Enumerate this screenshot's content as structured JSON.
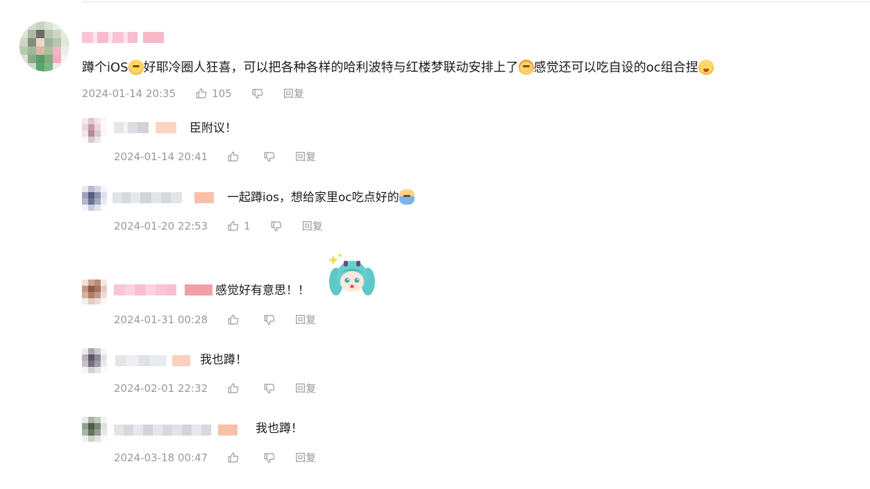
{
  "comments": [
    {
      "text": "蹲个iOS",
      "text2": "好耶冷圈人狂喜，可以把各种各样的哈利波特与红楼梦联动安排上了",
      "text3": "感觉还可以吃自设的oc组合捏",
      "time": "2024-01-14 20:35",
      "likes": "105",
      "reply_label": "回复",
      "emojis": [
        "shocked-emoji",
        "cat-emoji",
        "thinking-emoji"
      ]
    }
  ],
  "replies": [
    {
      "text": "臣附议！",
      "time": "2024-01-14 20:41",
      "likes": "",
      "reply_label": "回复"
    },
    {
      "text": "一起蹲ios，想给家里oc吃点好的",
      "time": "2024-01-20 22:53",
      "likes": "1",
      "reply_label": "回复",
      "emoji": "person-emoji"
    },
    {
      "text": "感觉好有意思！！",
      "time": "2024-01-31 00:28",
      "likes": "",
      "reply_label": "回复",
      "sticker": "anime-girl-sticker"
    },
    {
      "text": "我也蹲！",
      "time": "2024-02-01 22:32",
      "likes": "",
      "reply_label": "回复"
    },
    {
      "text": "我也蹲！",
      "time": "2024-03-18 00:47",
      "likes": "",
      "reply_label": "回复"
    }
  ],
  "colors": {
    "text": "#18191c",
    "meta": "#9499a0",
    "divider": "#e3e5e7",
    "username_pink": "#f7c2d3",
    "username_gray": "#dadde2",
    "username_peach": "#f5b79e"
  }
}
